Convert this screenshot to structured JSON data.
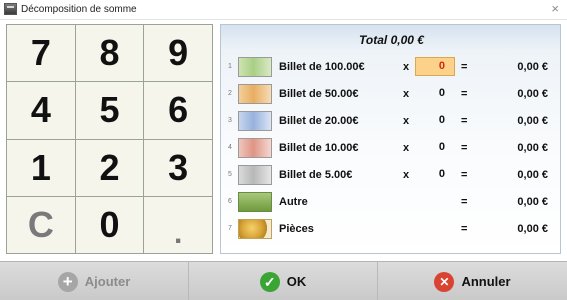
{
  "window": {
    "title": "Décomposition de somme",
    "close_glyph": "×"
  },
  "keypad": {
    "keys": [
      "7",
      "8",
      "9",
      "4",
      "5",
      "6",
      "1",
      "2",
      "3",
      "C",
      "0",
      "."
    ]
  },
  "summary": {
    "total_label": "Total 0,00 €"
  },
  "rows": [
    {
      "index": "1",
      "label": "Billet de 100.00€",
      "times": "x",
      "qty": "0",
      "eq": "=",
      "amount": "0,00 €",
      "icon": "banknote-100-icon"
    },
    {
      "index": "2",
      "label": "Billet de 50.00€",
      "times": "x",
      "qty": "0",
      "eq": "=",
      "amount": "0,00 €",
      "icon": "banknote-50-icon"
    },
    {
      "index": "3",
      "label": "Billet de 20.00€",
      "times": "x",
      "qty": "0",
      "eq": "=",
      "amount": "0,00 €",
      "icon": "banknote-20-icon"
    },
    {
      "index": "4",
      "label": "Billet de 10.00€",
      "times": "x",
      "qty": "0",
      "eq": "=",
      "amount": "0,00 €",
      "icon": "banknote-10-icon"
    },
    {
      "index": "5",
      "label": "Billet de 5.00€",
      "times": "x",
      "qty": "0",
      "eq": "=",
      "amount": "0,00 €",
      "icon": "banknote-5-icon"
    },
    {
      "index": "6",
      "label": "Autre",
      "eq": "=",
      "amount": "0,00 €",
      "icon": "money-stack-icon"
    },
    {
      "index": "7",
      "label": "Pièces",
      "eq": "=",
      "amount": "0,00 €",
      "icon": "coins-icon"
    }
  ],
  "buttons": {
    "add": {
      "label": "Ajouter",
      "icon": "plus-icon",
      "glyph": "+"
    },
    "ok": {
      "label": "OK",
      "icon": "check-icon",
      "glyph": "✓"
    },
    "cancel": {
      "label": "Annuler",
      "icon": "close-icon",
      "glyph": "✕"
    }
  },
  "colors": {
    "active_field_bg": "#fcd28a",
    "active_field_text": "#cf2a10",
    "ok_green": "#3aa535",
    "cancel_red": "#d94432"
  }
}
